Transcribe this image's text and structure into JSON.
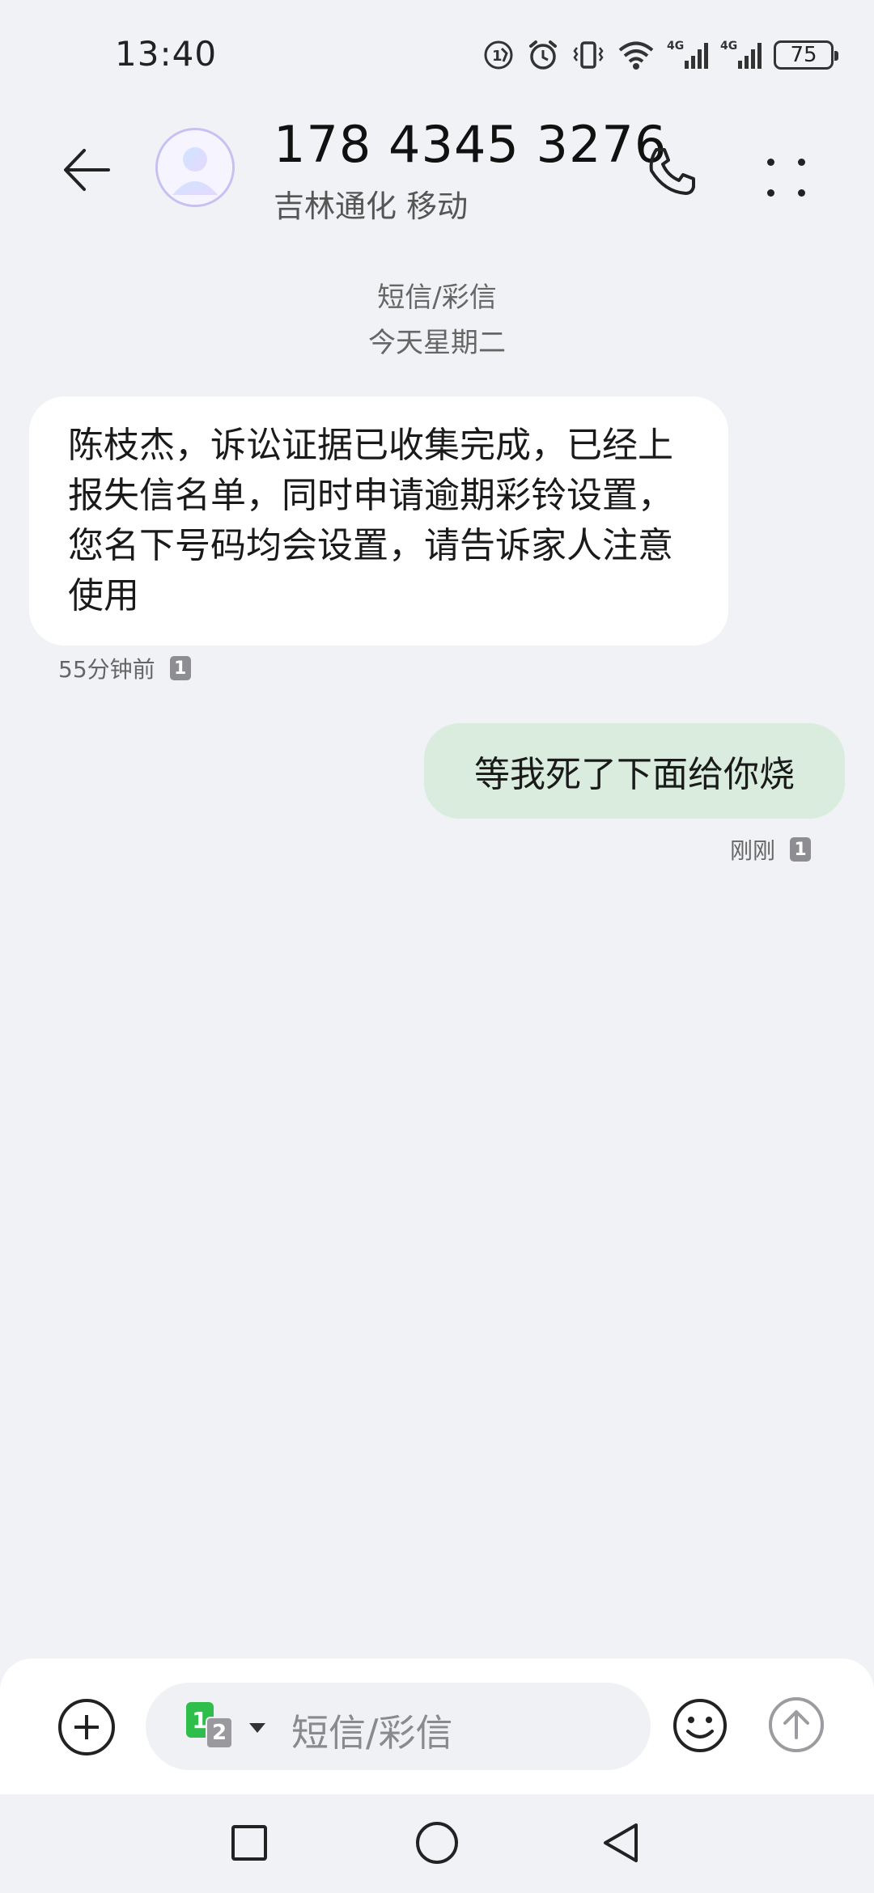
{
  "status_bar": {
    "time": "13:40",
    "icons": [
      "hd-call-icon",
      "alarm-icon",
      "vibrate-icon",
      "wifi-icon",
      "4g-signal-icon",
      "4g-signal-icon"
    ],
    "network_labels": [
      "4G",
      "4G"
    ],
    "battery": "75"
  },
  "header": {
    "contact_number": "178 4345 3276",
    "contact_sub": "吉林通化 移动",
    "icons": {
      "back": "back-arrow-icon",
      "avatar": "person-icon",
      "call": "phone-icon",
      "more": "more-dots-icon"
    }
  },
  "conversation": {
    "type_label": "短信/彩信",
    "date_label": "今天星期二",
    "messages": [
      {
        "direction": "incoming",
        "text": "陈枝杰，诉讼证据已收集完成，已经上报失信名单，同时申请逾期彩铃设置，您名下号码均会设置，请告诉家人注意使用",
        "time": "55分钟前",
        "sim": "1"
      },
      {
        "direction": "outgoing",
        "text": "等我死了下面给你烧",
        "time": "刚刚",
        "sim": "1"
      }
    ]
  },
  "composer": {
    "placeholder": "短信/彩信",
    "sim_primary": "1",
    "sim_secondary": "2",
    "icons": {
      "add": "plus-circle-icon",
      "emoji": "smiley-icon",
      "send": "send-arrow-icon"
    }
  },
  "colors": {
    "background": "#f1f2f6",
    "incoming_bubble": "#ffffff",
    "outgoing_bubble": "#d9ecdd",
    "sim1": "#2fbe4b"
  }
}
